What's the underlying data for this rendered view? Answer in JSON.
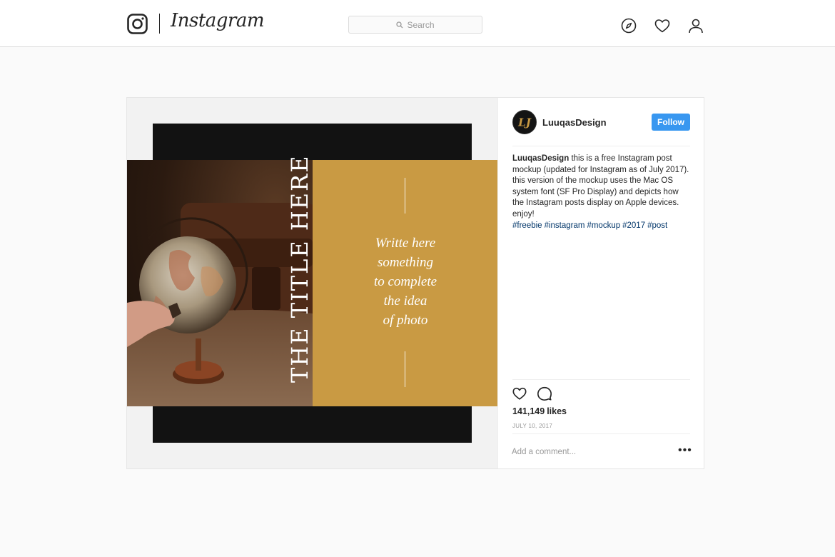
{
  "header": {
    "logo_text": "Instagram",
    "search": {
      "placeholder": "Search"
    },
    "nav_icons": [
      "compass-icon",
      "heart-icon",
      "person-icon"
    ]
  },
  "post": {
    "artwork": {
      "title": "THE TITLE HERE",
      "text_lines": [
        "Writte here",
        "something",
        "to complete",
        "the idea",
        "of photo"
      ]
    },
    "author": {
      "username": "LuuqasDesign",
      "avatar_initials": "LJ"
    },
    "follow_label": "Follow",
    "caption": {
      "username": "LuuqasDesign",
      "text": "this is a free Instagram post mockup (updated for Instagram as of July 2017). this version of the mockup uses the Mac OS system font (SF Pro Display) and depicts how the Instagram posts display on Apple devices. enjoy!",
      "hashtags": [
        "#freebie",
        "#instagram",
        "#mockup",
        "#2017",
        "#post"
      ]
    },
    "likes_count": "141,149",
    "likes_label": "likes",
    "date": "JULY 10, 2017",
    "comment_placeholder": "Add a comment...",
    "more_label": "•••"
  },
  "colors": {
    "follow_button": "#3897f0",
    "panel": "#c99a43",
    "hashtag": "#003569"
  }
}
